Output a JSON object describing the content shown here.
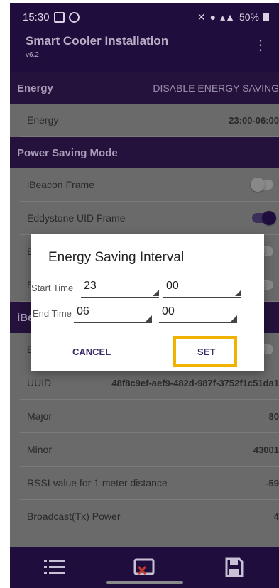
{
  "status": {
    "time": "15:30",
    "right": "50%"
  },
  "app": {
    "title": "Smart Cooler Installation",
    "version": "v6.2"
  },
  "energy_section": {
    "title": "Energy",
    "action": "DISABLE ENERGY SAVING"
  },
  "energy_row": {
    "label": "Energy",
    "value": "23:00-06:00"
  },
  "power_section": {
    "title": "Power Saving Mode"
  },
  "toggles": [
    {
      "label": "iBeacon Frame",
      "on": false
    },
    {
      "label": "Eddystone UID Frame",
      "on": true
    },
    {
      "label": "E",
      "on": false
    },
    {
      "label": "E",
      "on": false
    }
  ],
  "ibeacon_section": {
    "title": "iBe"
  },
  "ibeacon_toggle": {
    "label": "E"
  },
  "info_rows": [
    {
      "label": "UUID",
      "value": "48f8c9ef-aef9-482d-987f-3752f1c51da1"
    },
    {
      "label": "Major",
      "value": "80"
    },
    {
      "label": "Minor",
      "value": "43001"
    },
    {
      "label": "RSSI value for 1 meter distance",
      "value": "-59"
    },
    {
      "label": "Broadcast(Tx) Power",
      "value": "4"
    }
  ],
  "dialog": {
    "title": "Energy Saving Interval",
    "start_label": "Start Time",
    "start_hour": "23",
    "start_min": "00",
    "end_label": "End Time",
    "end_hour": "06",
    "end_min": "00",
    "cancel": "CANCEL",
    "set": "SET"
  },
  "colors": {
    "header": "#1f0d3d",
    "highlight": "#f0b400",
    "accent": "#3a2a6a"
  }
}
